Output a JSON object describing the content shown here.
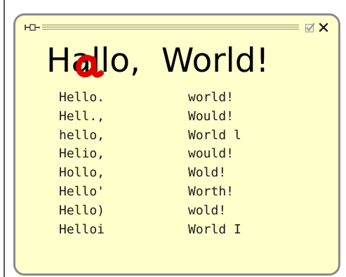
{
  "headline": "Hallo,  World!",
  "suggestions": [
    {
      "left": "Hello.",
      "right": "world!"
    },
    {
      "left": "Hell.,",
      "right": "Would!"
    },
    {
      "left": "hello,",
      "right": "World l"
    },
    {
      "left": "Helio,",
      "right": "would!"
    },
    {
      "left": "Hollo,",
      "right": "Wold!"
    },
    {
      "left": "Hello'",
      "right": "Worth!"
    },
    {
      "left": "Hello)",
      "right": "wold!"
    },
    {
      "left": "Helloi",
      "right": "World I"
    }
  ],
  "icons": {
    "pin": "pin-icon",
    "check": "checkbox-check-icon",
    "close": "close-icon"
  },
  "colors": {
    "panel_background": "#ffffcc",
    "panel_border": "#8b8b8b",
    "ink_correction": "#e00000",
    "text": "#000000"
  }
}
